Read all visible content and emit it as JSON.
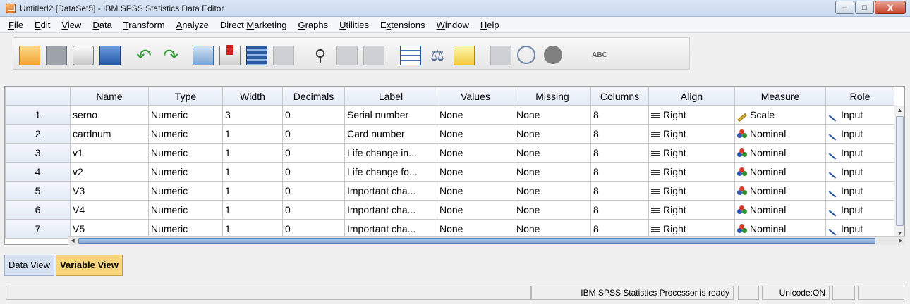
{
  "window": {
    "title": "Untitled2 [DataSet5] - IBM SPSS Statistics Data Editor",
    "min_glyph": "–",
    "max_glyph": "□",
    "close_glyph": "X"
  },
  "menu": [
    {
      "pre": "",
      "u": "F",
      "post": "ile"
    },
    {
      "pre": "",
      "u": "E",
      "post": "dit"
    },
    {
      "pre": "",
      "u": "V",
      "post": "iew"
    },
    {
      "pre": "",
      "u": "D",
      "post": "ata"
    },
    {
      "pre": "",
      "u": "T",
      "post": "ransform"
    },
    {
      "pre": "",
      "u": "A",
      "post": "nalyze"
    },
    {
      "pre": "Direct ",
      "u": "M",
      "post": "arketing"
    },
    {
      "pre": "",
      "u": "G",
      "post": "raphs"
    },
    {
      "pre": "",
      "u": "U",
      "post": "tilities"
    },
    {
      "pre": "E",
      "u": "x",
      "post": "tensions"
    },
    {
      "pre": "",
      "u": "W",
      "post": "indow"
    },
    {
      "pre": "",
      "u": "H",
      "post": "elp"
    }
  ],
  "toolbar": {
    "undo_glyph": "↶",
    "redo_glyph": "↷",
    "find_glyph": "⚲",
    "scale_glyph": "⚖",
    "spell_label": "ABC"
  },
  "columns": [
    "",
    "Name",
    "Type",
    "Width",
    "Decimals",
    "Label",
    "Values",
    "Missing",
    "Columns",
    "Align",
    "Measure",
    "Role"
  ],
  "rows": [
    {
      "num": "1",
      "name": "serno",
      "type": "Numeric",
      "width": "3",
      "decimals": "0",
      "label": "Serial number",
      "values": "None",
      "missing": "None",
      "columns": "8",
      "align": "Right",
      "measure": "Scale",
      "measure_icon": "ruler-icon",
      "role": "Input"
    },
    {
      "num": "2",
      "name": "cardnum",
      "type": "Numeric",
      "width": "1",
      "decimals": "0",
      "label": "Card number",
      "values": "None",
      "missing": "None",
      "columns": "8",
      "align": "Right",
      "measure": "Nominal",
      "measure_icon": "nominal-icon",
      "role": "Input"
    },
    {
      "num": "3",
      "name": "v1",
      "type": "Numeric",
      "width": "1",
      "decimals": "0",
      "label": "Life change in...",
      "values": "None",
      "missing": "None",
      "columns": "8",
      "align": "Right",
      "measure": "Nominal",
      "measure_icon": "nominal-icon",
      "role": "Input"
    },
    {
      "num": "4",
      "name": "v2",
      "type": "Numeric",
      "width": "1",
      "decimals": "0",
      "label": "Life change fo...",
      "values": "None",
      "missing": "None",
      "columns": "8",
      "align": "Right",
      "measure": "Nominal",
      "measure_icon": "nominal-icon",
      "role": "Input"
    },
    {
      "num": "5",
      "name": "V3",
      "type": "Numeric",
      "width": "1",
      "decimals": "0",
      "label": "Important cha...",
      "values": "None",
      "missing": "None",
      "columns": "8",
      "align": "Right",
      "measure": "Nominal",
      "measure_icon": "nominal-icon",
      "role": "Input"
    },
    {
      "num": "6",
      "name": "V4",
      "type": "Numeric",
      "width": "1",
      "decimals": "0",
      "label": "Important cha...",
      "values": "None",
      "missing": "None",
      "columns": "8",
      "align": "Right",
      "measure": "Nominal",
      "measure_icon": "nominal-icon",
      "role": "Input"
    },
    {
      "num": "7",
      "name": "V5",
      "type": "Numeric",
      "width": "1",
      "decimals": "0",
      "label": "Important cha...",
      "values": "None",
      "missing": "None",
      "columns": "8",
      "align": "Right",
      "measure": "Nominal",
      "measure_icon": "nominal-icon",
      "role": "Input"
    }
  ],
  "tabs": {
    "data_view": "Data View",
    "variable_view": "Variable View",
    "active": "Variable View"
  },
  "status": {
    "processor": "IBM SPSS Statistics Processor is ready",
    "unicode": "Unicode:ON"
  },
  "colors": {
    "active_tab": "#f7d57a",
    "inactive_tab": "#d6e2f2",
    "header_bg": "#e3ebf6"
  }
}
